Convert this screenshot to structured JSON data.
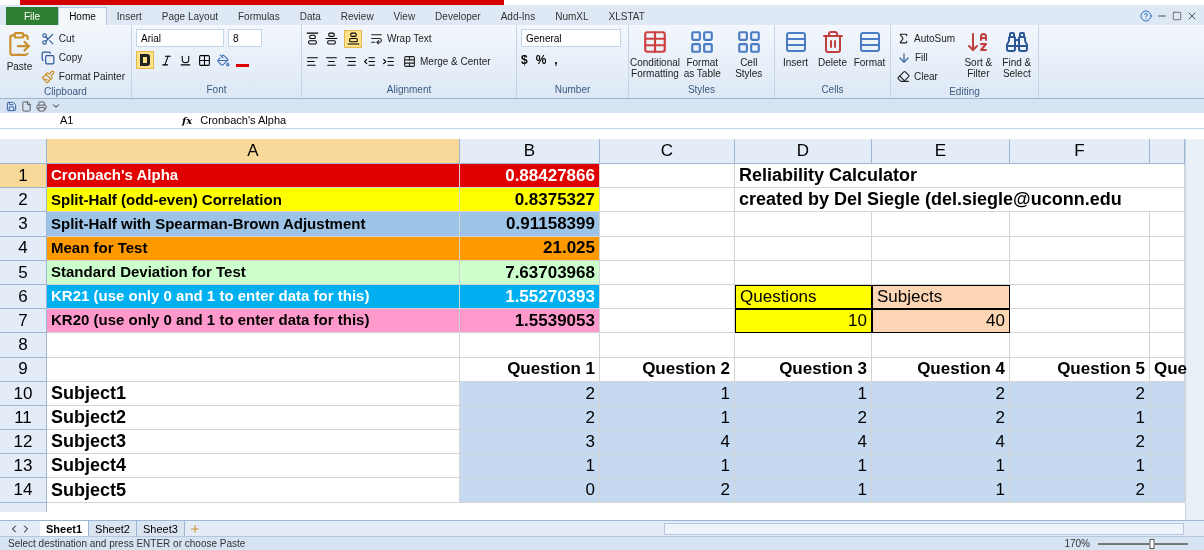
{
  "ribbon_tabs": [
    {
      "label": "File",
      "kind": "file",
      "selected": false
    },
    {
      "label": "Home",
      "kind": "tab",
      "selected": true
    },
    {
      "label": "Insert",
      "kind": "tab",
      "selected": false
    },
    {
      "label": "Page Layout",
      "kind": "tab",
      "selected": false
    },
    {
      "label": "Formulas",
      "kind": "tab",
      "selected": false
    },
    {
      "label": "Data",
      "kind": "tab",
      "selected": false
    },
    {
      "label": "Review",
      "kind": "tab",
      "selected": false
    },
    {
      "label": "View",
      "kind": "tab",
      "selected": false
    },
    {
      "label": "Developer",
      "kind": "tab",
      "selected": false
    },
    {
      "label": "Add-Ins",
      "kind": "tab",
      "selected": false
    },
    {
      "label": "NumXL",
      "kind": "tab",
      "selected": false
    },
    {
      "label": "XLSTAT",
      "kind": "tab",
      "selected": false
    }
  ],
  "clipboard": {
    "label": "Clipboard",
    "paste": "Paste",
    "cut": "Cut",
    "copy": "Copy",
    "format_painter": "Format Painter"
  },
  "font": {
    "label": "Font",
    "name": "Arial",
    "size": "8",
    "bold_selected": true
  },
  "alignment": {
    "label": "Alignment",
    "wrap_text": "Wrap Text",
    "merge_center": "Merge & Center",
    "bottom_align_selected": true
  },
  "number": {
    "label": "Number",
    "format": "General",
    "currency": "$",
    "percent": "%",
    "comma": ","
  },
  "styles": {
    "label": "Styles",
    "buttons": [
      "Conditional Formatting",
      "Format as Table",
      "Cell Styles"
    ]
  },
  "cells": {
    "label": "Cells",
    "buttons": [
      "Insert",
      "Delete",
      "Format"
    ]
  },
  "editing": {
    "label": "Editing",
    "autosum": "AutoSum",
    "fill": "Fill",
    "clear": "Clear",
    "buttons": [
      "Sort & Filter",
      "Find & Select"
    ]
  },
  "formula_bar": {
    "name_box": "A1",
    "fx": "fx",
    "formula": "Cronbach's Alpha"
  },
  "columns": [
    {
      "label": "A",
      "selected": true
    },
    {
      "label": "B",
      "selected": false
    },
    {
      "label": "C",
      "selected": false
    },
    {
      "label": "D",
      "selected": false
    },
    {
      "label": "E",
      "selected": false
    },
    {
      "label": "F",
      "selected": false
    },
    {
      "selected": false
    }
  ],
  "rows": [
    {
      "header": "1",
      "selected": true,
      "cells": [
        {
          "text": "Cronbach's Alpha",
          "color": "#e00000",
          "kind": "label"
        },
        {
          "text": "0.88427866",
          "color": "#e00000",
          "kind": "value"
        },
        {},
        {
          "text": "Reliability Calculator",
          "kind": "title"
        }
      ]
    },
    {
      "header": "2",
      "selected": false,
      "cells": [
        {
          "text": "Split-Half (odd-even) Correlation",
          "color": "#ffff00",
          "kind": "label"
        },
        {
          "text": "0.8375327",
          "color": "#ffff00",
          "kind": "value"
        },
        {},
        {
          "text": "created by Del Siegle (del.siegle@uconn.edu",
          "kind": "title"
        }
      ]
    },
    {
      "header": "3",
      "selected": false,
      "cells": [
        {
          "text": "Split-Half with Spearman-Brown Adjustment",
          "color": "#9dc3e6",
          "kind": "label"
        },
        {
          "text": "0.91158399",
          "color": "#9dc3e6",
          "kind": "value"
        },
        {},
        {},
        {},
        {},
        {}
      ]
    },
    {
      "header": "4",
      "selected": false,
      "cells": [
        {
          "text": "Mean for Test",
          "color": "#ff9900",
          "kind": "label"
        },
        {
          "text": "21.025",
          "color": "#ff9900",
          "kind": "value"
        },
        {},
        {},
        {},
        {},
        {}
      ]
    },
    {
      "header": "5",
      "selected": false,
      "cells": [
        {
          "text": "Standard Deviation for Test",
          "color": "#ccffcc",
          "kind": "label"
        },
        {
          "text": "7.63703968",
          "color": "#ccffcc",
          "kind": "value"
        },
        {},
        {},
        {},
        {},
        {}
      ]
    },
    {
      "header": "6",
      "selected": false,
      "cells": [
        {
          "text": "KR21 (use only 0 and 1 to enter data for this)",
          "color": "#00b0f0",
          "kind": "label"
        },
        {
          "text": "1.55270393",
          "color": "#00b0f0",
          "kind": "value"
        },
        {},
        {
          "text": "Questions",
          "color": "#ffff00",
          "kind": "input_label"
        },
        {
          "text": "Subjects",
          "color": "#fcd5b4",
          "kind": "input_label"
        },
        {},
        {}
      ]
    },
    {
      "header": "7",
      "selected": false,
      "cells": [
        {
          "text": "KR20 (use only 0 and 1 to enter data for this)",
          "color": "#ff99cc",
          "kind": "label"
        },
        {
          "text": "1.5539053",
          "color": "#ff99cc",
          "kind": "value"
        },
        {},
        {
          "text": "10",
          "color": "#ffff00",
          "kind": "input_value"
        },
        {
          "text": "40",
          "color": "#fcd5b4",
          "kind": "input_value"
        },
        {},
        {}
      ]
    },
    {
      "header": "8",
      "selected": false,
      "cells": [
        {},
        {},
        {},
        {},
        {},
        {},
        {}
      ]
    },
    {
      "header": "9",
      "selected": false,
      "cells": [
        {},
        {
          "text": "Question 1",
          "kind": "heading"
        },
        {
          "text": "Question 2",
          "kind": "heading"
        },
        {
          "text": "Question 3",
          "kind": "heading"
        },
        {
          "text": "Question 4",
          "kind": "heading"
        },
        {
          "text": "Question 5",
          "kind": "heading"
        },
        {
          "text": "Que",
          "kind": "heading"
        }
      ]
    },
    {
      "header": "10",
      "selected": false,
      "cells": [
        {
          "text": "Subject1",
          "kind": "subject"
        },
        {
          "text": "2",
          "color": "#c5d9f1",
          "kind": "data"
        },
        {
          "text": "1",
          "color": "#c5d9f1",
          "kind": "data"
        },
        {
          "text": "1",
          "color": "#c5d9f1",
          "kind": "data"
        },
        {
          "text": "2",
          "color": "#c5d9f1",
          "kind": "data"
        },
        {
          "text": "2",
          "color": "#c5d9f1",
          "kind": "data"
        },
        {
          "color": "#c5d9f1",
          "kind": "data"
        }
      ]
    },
    {
      "header": "11",
      "selected": false,
      "cells": [
        {
          "text": "Subject2",
          "kind": "subject"
        },
        {
          "text": "2",
          "color": "#c5d9f1",
          "kind": "data"
        },
        {
          "text": "1",
          "color": "#c5d9f1",
          "kind": "data"
        },
        {
          "text": "2",
          "color": "#c5d9f1",
          "kind": "data"
        },
        {
          "text": "2",
          "color": "#c5d9f1",
          "kind": "data"
        },
        {
          "text": "1",
          "color": "#c5d9f1",
          "kind": "data"
        },
        {
          "color": "#c5d9f1",
          "kind": "data"
        }
      ]
    },
    {
      "header": "12",
      "selected": false,
      "cells": [
        {
          "text": "Subject3",
          "kind": "subject"
        },
        {
          "text": "3",
          "color": "#c5d9f1",
          "kind": "data"
        },
        {
          "text": "4",
          "color": "#c5d9f1",
          "kind": "data"
        },
        {
          "text": "4",
          "color": "#c5d9f1",
          "kind": "data"
        },
        {
          "text": "4",
          "color": "#c5d9f1",
          "kind": "data"
        },
        {
          "text": "2",
          "color": "#c5d9f1",
          "kind": "data"
        },
        {
          "color": "#c5d9f1",
          "kind": "data"
        }
      ]
    },
    {
      "header": "13",
      "selected": false,
      "cells": [
        {
          "text": "Subject4",
          "kind": "subject"
        },
        {
          "text": "1",
          "color": "#c5d9f1",
          "kind": "data"
        },
        {
          "text": "1",
          "color": "#c5d9f1",
          "kind": "data"
        },
        {
          "text": "1",
          "color": "#c5d9f1",
          "kind": "data"
        },
        {
          "text": "1",
          "color": "#c5d9f1",
          "kind": "data"
        },
        {
          "text": "1",
          "color": "#c5d9f1",
          "kind": "data"
        },
        {
          "color": "#c5d9f1",
          "kind": "data"
        }
      ]
    },
    {
      "header": "14",
      "selected": false,
      "cells": [
        {
          "text": "Subject5",
          "kind": "subject"
        },
        {
          "text": "0",
          "color": "#c5d9f1",
          "kind": "data"
        },
        {
          "text": "2",
          "color": "#c5d9f1",
          "kind": "data"
        },
        {
          "text": "1",
          "color": "#c5d9f1",
          "kind": "data"
        },
        {
          "text": "1",
          "color": "#c5d9f1",
          "kind": "data"
        },
        {
          "text": "2",
          "color": "#c5d9f1",
          "kind": "data"
        },
        {
          "color": "#c5d9f1",
          "kind": "data"
        }
      ]
    }
  ],
  "sheet_tabs": [
    {
      "label": "Sheet1",
      "selected": true
    },
    {
      "label": "Sheet2",
      "selected": false
    },
    {
      "label": "Sheet3",
      "selected": false
    }
  ],
  "status_bar": {
    "message": "Select destination and press ENTER or choose Paste",
    "zoom": "170%",
    "zoom_slider": {
      "level": 0.6
    }
  }
}
